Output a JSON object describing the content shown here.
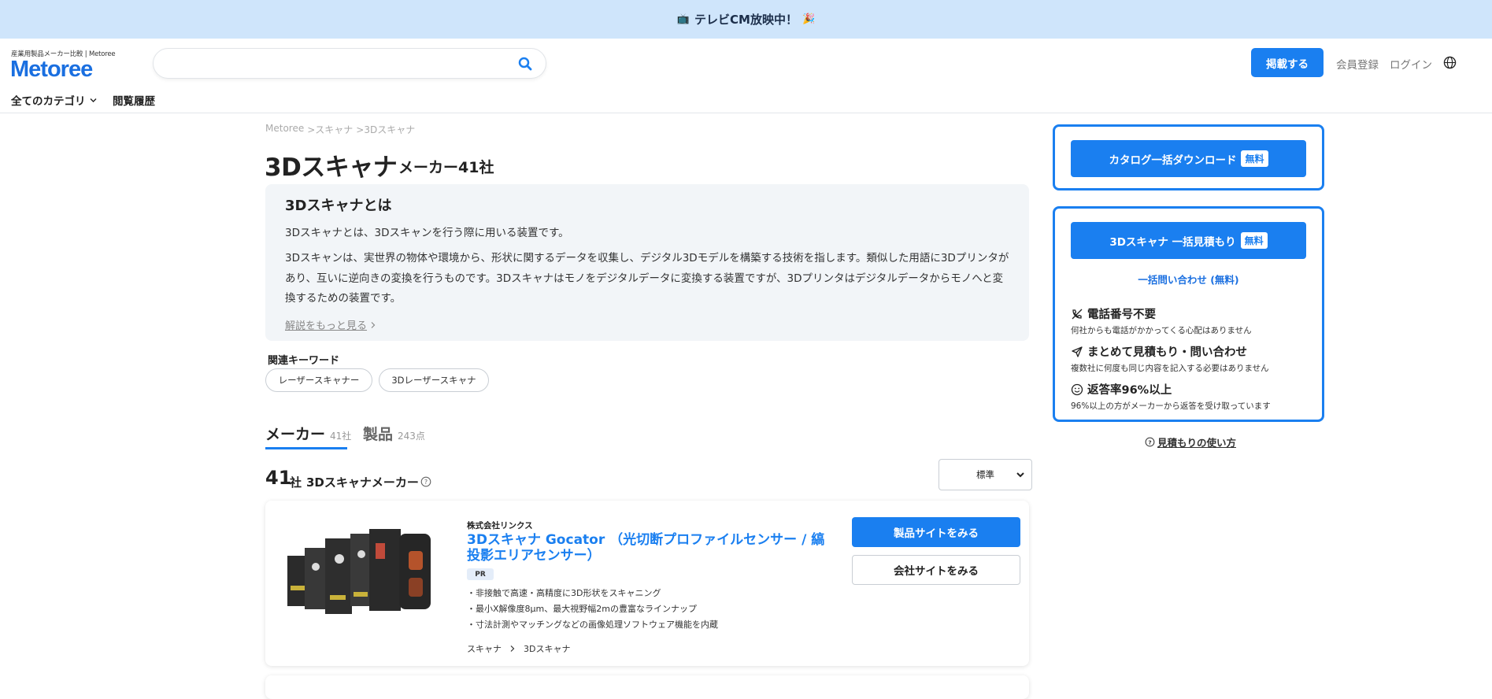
{
  "banner": {
    "text": "テレビCM放映中！"
  },
  "header": {
    "logo_tagline": "産業用製品メーカー比較 | Metoree",
    "logo": "Metoree",
    "search_placeholder": "",
    "publish_label": "掲載する",
    "register_label": "会員登録",
    "login_label": "ログイン",
    "all_categories": "全てのカテゴリ",
    "history": "閲覧履歴"
  },
  "breadcrumb": [
    "Metoree",
    ">スキャナ",
    ">3Dスキャナ"
  ],
  "page": {
    "title": "3Dスキャナ",
    "maker_count": "メーカー41社"
  },
  "description": {
    "title": "3Dスキャナとは",
    "p1": "3Dスキャナとは、3Dスキャンを行う際に用いる装置です。",
    "p2": "3Dスキャンは、実世界の物体や環境から、形状に関するデータを収集し、デジタル3Dモデルを構築する技術を指します。類似した用語に3Dプリンタがあり、互いに逆向きの変換を行うものです。3Dスキャナはモノをデジタルデータに変換する装置ですが、3Dプリンタはデジタルデータからモノへと変換するための装置です。",
    "more": "解説をもっと見る"
  },
  "keywords": {
    "label": "関連キーワード",
    "items": [
      "レーザースキャナー",
      "3Dレーザースキャナ"
    ]
  },
  "tabs": [
    {
      "label": "メーカー",
      "count": "41社"
    },
    {
      "label": "製品",
      "count": "243点"
    }
  ],
  "results": {
    "count": "41",
    "unit": "社",
    "title": "3Dスキャナメーカー",
    "sort": "標準"
  },
  "card": {
    "company": "株式会社リンクス",
    "product_name": "3Dスキャナ Gocator （光切断プロファイルセンサー / 縞投影エリアセンサー）",
    "badge": "PR",
    "features": [
      "・非接触で高速・高精度に3D形状をスキャニング",
      "・最小X解像度8μm、最大視野幅2mの豊富なラインナップ",
      "・寸法計測やマッチングなどの画像処理ソフトウェア機能を内蔵"
    ],
    "category": "スキャナ",
    "subcategory": "3Dスキャナ",
    "product_site": "製品サイトをみる",
    "company_site": "会社サイトをみる"
  },
  "sidebar": {
    "catalog_btn": "カタログ一括ダウンロード",
    "free": "無料",
    "quote_btn": "3Dスキャナ 一括見積もり",
    "inquiry_link": "一括問い合わせ (無料)",
    "benefits": [
      {
        "title": "電話番号不要",
        "sub": "何社からも電話がかかってくる心配はありません"
      },
      {
        "title": "まとめて見積もり・問い合わせ",
        "sub": "複数社に何度も同じ内容を記入する必要はありません"
      },
      {
        "title": "返答率96%以上",
        "sub": "96%以上の方がメーカーから返答を受け取っています"
      }
    ],
    "howto": "見積もりの使い方"
  },
  "colors": {
    "accent": "#1a7ff0",
    "banner_bg": "#cfe5fb",
    "desc_bg": "#f2f5f8"
  }
}
